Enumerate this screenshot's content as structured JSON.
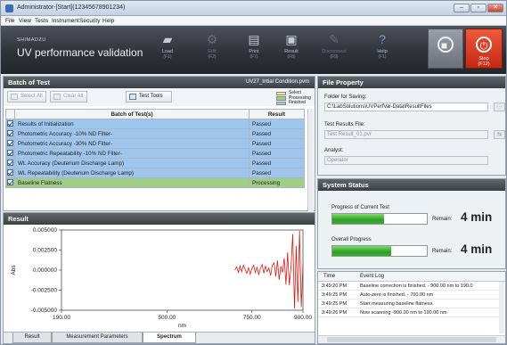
{
  "window": {
    "title": "Administrator-[Start](12345678901234)"
  },
  "menu": [
    "File",
    "View",
    "Tests",
    "Instrument",
    "Security",
    "Help"
  ],
  "toolbar": {
    "brand": "SHIMADZU",
    "app_title": "UV performance validation",
    "buttons": [
      {
        "label": "Load",
        "key": "(F1)",
        "icon": "load-icon",
        "state": "normal"
      },
      {
        "label": "Edit",
        "key": "(F2)",
        "icon": "edit-icon",
        "state": "dim"
      },
      {
        "label": "Print",
        "key": "(F7)",
        "icon": "print-icon",
        "state": "normal"
      },
      {
        "label": "Result",
        "key": "(F8)",
        "icon": "result-icon",
        "state": "normal"
      },
      {
        "label": "Disconnect",
        "key": "(F9)",
        "icon": "disconnect-icon",
        "state": "dim"
      },
      {
        "label": "Help",
        "key": "(F1)",
        "icon": "help-icon",
        "state": "blue"
      }
    ],
    "stop": {
      "label": "Stop",
      "key": "(F12)"
    }
  },
  "batch": {
    "header": "Batch of Test",
    "file": "UV27_Intial Condition.pvm",
    "select_all": "Select All",
    "clear_all": "Clear All",
    "test_tools": "Test Tools",
    "legend": [
      {
        "label": "Select",
        "color": "#f2e48a"
      },
      {
        "label": "Processing",
        "color": "#9fcf86"
      },
      {
        "label": "Finished",
        "color": "#9ec6ee"
      }
    ],
    "columns": [
      "Batch of Test(s)",
      "Result"
    ],
    "rows": [
      {
        "name": "Results of Initialization",
        "result": "Passed",
        "state": "fin"
      },
      {
        "name": "Photometric Accuracy -10% ND Filter-",
        "result": "Passed",
        "state": "fin"
      },
      {
        "name": "Photometric Accuracy -30% ND Filter-",
        "result": "Passed",
        "state": "fin"
      },
      {
        "name": "Photometric Repeatability -10% ND Filter-",
        "result": "Passed",
        "state": "fin"
      },
      {
        "name": "WL Accuracy (Deuterium Discharge Lamp)",
        "result": "Passed",
        "state": "fin"
      },
      {
        "name": "WL Repeatability (Deuterium Discharge Lamp)",
        "result": "Passed",
        "state": "fin"
      },
      {
        "name": "Baseline Flatness",
        "result": "Processing",
        "state": "proc"
      }
    ]
  },
  "result": {
    "header": "Result",
    "tabs": [
      "Result",
      "Measurement Parameters",
      "Spectrum"
    ],
    "active_tab": "Spectrum"
  },
  "chart_data": {
    "type": "line",
    "xlabel": "nm",
    "ylabel": "Abs",
    "xlim": [
      190,
      900
    ],
    "ylim": [
      -0.005,
      0.005
    ],
    "x_ticks": [
      "190.00",
      "500.00",
      "750.00",
      "900.00"
    ],
    "y_ticks": [
      "0.005000",
      "0.002500",
      "0.000000",
      "-0.002500",
      "-0.005000"
    ],
    "series": [
      {
        "color": "#e01a10",
        "x": [
          700,
          705,
          710,
          715,
          720,
          725,
          730,
          735,
          740,
          745,
          750,
          755,
          760,
          765,
          770,
          775,
          780,
          785,
          790,
          795,
          800,
          805,
          810,
          815,
          820,
          825,
          830,
          835,
          840,
          845,
          850,
          855,
          860,
          865,
          870,
          875,
          880,
          885,
          890,
          895,
          900
        ],
        "y": [
          0.0,
          0.0004,
          -0.0003,
          0.0005,
          -0.0002,
          0.0006,
          0.0001,
          -0.0004,
          0.0003,
          -0.0005,
          0.0002,
          0.0006,
          -0.0003,
          0.0004,
          -0.0006,
          0.0002,
          0.0007,
          -0.0004,
          0.0005,
          -0.0002,
          0.0003,
          -0.0007,
          0.0006,
          0.0009,
          -0.0008,
          0.0012,
          -0.0012,
          0.0005,
          -0.0003,
          0.0015,
          -0.0018,
          0.0022,
          -0.0019,
          0.0004,
          0.0045,
          -0.0048,
          0.003,
          -0.004,
          0.0049,
          -0.0046,
          0.0008
        ]
      }
    ]
  },
  "file_property": {
    "header": "File Property",
    "folder_label": "Folder for Saving:",
    "folder_value": "C:\\LabSolutions\\UVPerfVal-Data\\ResultFiles",
    "results_label": "Test Results File:",
    "results_value": "Test Result_01.pvr",
    "analyst_label": "Analyst:",
    "analyst_value": "Operator"
  },
  "status": {
    "header": "System Status",
    "current_label": "Progress of Current Test",
    "current_progress": 0.55,
    "current_remain": "4 min",
    "overall_label": "Overall Progress",
    "overall_progress": 0.62,
    "overall_remain": "4 min",
    "remain_label": "Remain:"
  },
  "log": {
    "col_time": "Time",
    "col_event": "Event Log",
    "rows": [
      {
        "time": "3:49:20 PM",
        "event": "Baseline correction is finished. - 900.00 nm to 190.0"
      },
      {
        "time": "3:49:25 PM",
        "event": "Auto-zero is finished. - 700.00 nm"
      },
      {
        "time": "3:49:25 PM",
        "event": "Start measuring baseline flatness."
      },
      {
        "time": "3:49:26 PM",
        "event": "Now scanning -900.00 nm to 190.00 nm"
      }
    ]
  }
}
